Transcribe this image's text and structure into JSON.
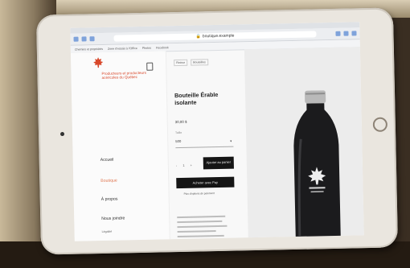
{
  "browser": {
    "url": "boutique.example",
    "bookmarks": [
      "Chemins et propriétés",
      "Zone d'essais à l'Office",
      "Photos",
      "Facebook"
    ]
  },
  "site": {
    "logo_text": "Producteurs et producteurs acéricoles du Québec",
    "nav": [
      {
        "label": "Accueil",
        "active": false
      },
      {
        "label": "Boutique",
        "active": true
      },
      {
        "label": "À propos",
        "active": false
      },
      {
        "label": "Nous joindre",
        "active": false
      }
    ],
    "footer_label": "Légalité"
  },
  "breadcrumbs": [
    "Retour",
    "Bouteilles"
  ],
  "product": {
    "title": "Bouteille Érable isolante",
    "price": "30,00 $",
    "quantity_label": "Taille",
    "option_value": "500",
    "quantity_controls": "- 1 +",
    "add_to_cart_label": "Ajouter au panier",
    "buy_label": "Acheter avec  Pay",
    "more_payment_label": "Plus d'options de paiement",
    "image_alt": "black insulated bottle with maple leaf logo"
  },
  "colors": {
    "accent": "#d8482b",
    "button": "#151515"
  }
}
